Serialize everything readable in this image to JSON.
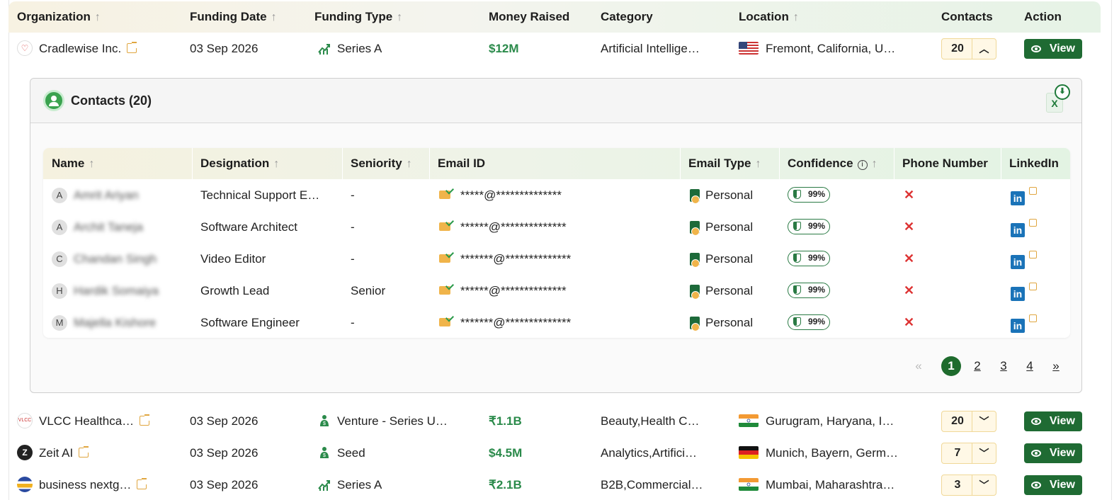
{
  "columns": {
    "organization": "Organization",
    "funding_date": "Funding Date",
    "funding_type": "Funding Type",
    "money_raised": "Money Raised",
    "category": "Category",
    "location": "Location",
    "contacts": "Contacts",
    "action": "Action"
  },
  "sort_glyph": "↑",
  "view_label": "View",
  "rows": [
    {
      "org": "Cradlewise Inc.",
      "date": "03 Sep 2026",
      "type": "Series A",
      "money": "$12M",
      "category": "Artificial Intellige…",
      "location": "Fremont, California, U…",
      "contacts": "20",
      "expanded": true,
      "flag": "us"
    },
    {
      "org": "VLCC Healthca…",
      "date": "03 Sep 2026",
      "type": "Venture - Series U…",
      "money": "₹1.1B",
      "category": "Beauty,Health C…",
      "location": "Gurugram, Haryana, I…",
      "contacts": "20",
      "expanded": false,
      "flag": "in"
    },
    {
      "org": "Zeit AI",
      "date": "03 Sep 2026",
      "type": "Seed",
      "money": "$4.5M",
      "category": "Analytics,Artifici…",
      "location": "Munich, Bayern, Germ…",
      "contacts": "7",
      "expanded": false,
      "flag": "de"
    },
    {
      "org": "business nextg…",
      "date": "03 Sep 2026",
      "type": "Series A",
      "money": "₹2.1B",
      "category": "B2B,Commercial…",
      "location": "Mumbai, Maharashtra…",
      "contacts": "3",
      "expanded": false,
      "flag": "in"
    }
  ],
  "contacts_panel": {
    "title": "Contacts (20)",
    "excel_label": "X",
    "columns": {
      "name": "Name",
      "designation": "Designation",
      "seniority": "Seniority",
      "email": "Email ID",
      "email_type": "Email Type",
      "confidence": "Confidence",
      "phone": "Phone Number",
      "linkedin": "LinkedIn"
    },
    "contacts": [
      {
        "initial": "A",
        "name": "Amrit Ariyan",
        "designation": "Technical Support E…",
        "seniority": "-",
        "email": "*****@**************",
        "email_type": "Personal",
        "confidence": "99%",
        "phone": "✕"
      },
      {
        "initial": "A",
        "name": "Archit Taneja",
        "designation": "Software Architect",
        "seniority": "-",
        "email": "******@**************",
        "email_type": "Personal",
        "confidence": "99%",
        "phone": "✕"
      },
      {
        "initial": "C",
        "name": "Chandan Singh",
        "designation": "Video Editor",
        "seniority": "-",
        "email": "*******@**************",
        "email_type": "Personal",
        "confidence": "99%",
        "phone": "✕"
      },
      {
        "initial": "H",
        "name": "Hardik Somaiya",
        "designation": "Growth Lead",
        "seniority": "Senior",
        "email": "******@**************",
        "email_type": "Personal",
        "confidence": "99%",
        "phone": "✕"
      },
      {
        "initial": "M",
        "name": "Majella Kishore",
        "designation": "Software Engineer",
        "seniority": "-",
        "email": "*******@**************",
        "email_type": "Personal",
        "confidence": "99%",
        "phone": "✕"
      }
    ],
    "pagination": {
      "prev": "«",
      "pages": [
        "1",
        "2",
        "3",
        "4"
      ],
      "next": "»",
      "current": "1"
    }
  },
  "colors": {
    "accent": "#1f6b33",
    "money": "#2a8a4a",
    "warning": "#e0a640",
    "error": "#d33"
  }
}
